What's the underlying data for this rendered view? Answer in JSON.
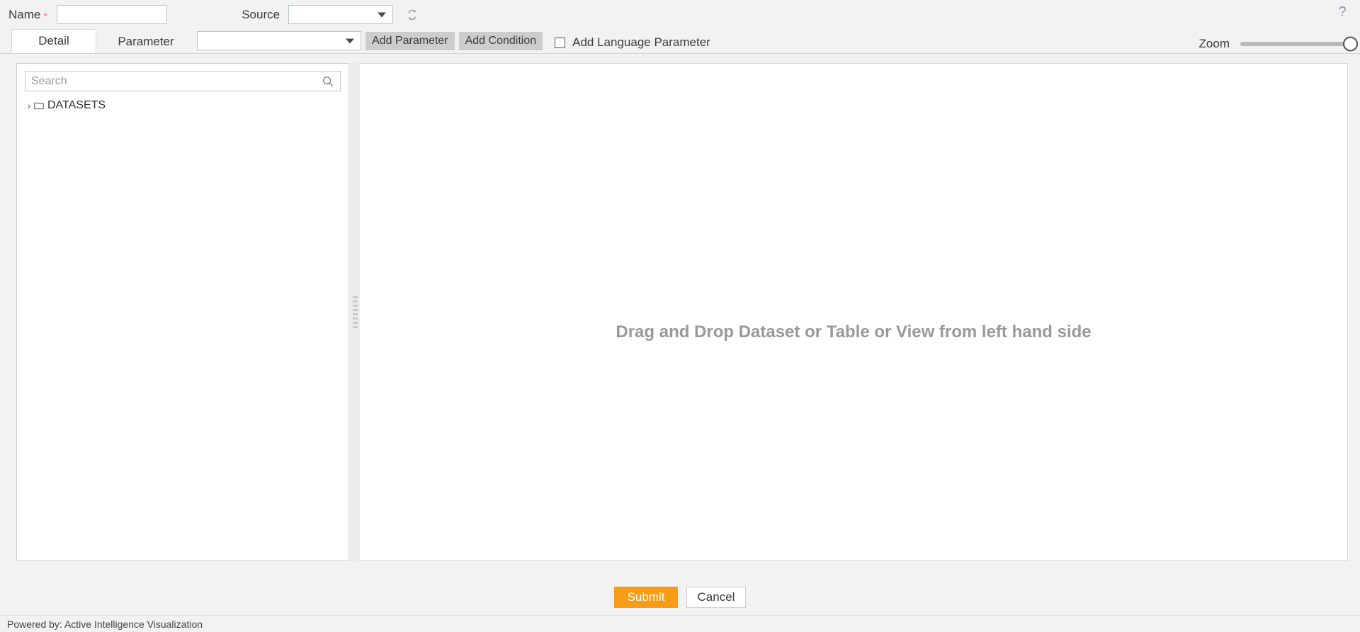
{
  "topbar": {
    "name_label": "Name",
    "required_marker": "*",
    "name_value": "",
    "name_placeholder": "",
    "source_label": "Source",
    "source_value": "",
    "refresh_icon": "refresh-icon",
    "help_icon": "question-mark-icon",
    "help_label": "?"
  },
  "tabs": [
    {
      "label": "Detail",
      "active": true
    },
    {
      "label": "Parameter",
      "active": false
    }
  ],
  "toolbar": {
    "parameter_select_value": "",
    "add_parameter_label": "Add Parameter",
    "add_condition_label": "Add Condition",
    "add_language_parameter_label": "Add Language Parameter",
    "add_language_parameter_checked": false,
    "zoom_label": "Zoom",
    "zoom_value": 100
  },
  "left_panel": {
    "search_placeholder": "Search",
    "search_value": "",
    "search_icon": "magnifier-icon",
    "tree": [
      {
        "label": "DATASETS",
        "expanded": false,
        "arrow_icon": "chevron-right-icon",
        "folder_icon": "folder-icon"
      }
    ]
  },
  "right_panel": {
    "drop_hint": "Drag and Drop Dataset or Table or View from left hand side"
  },
  "footer": {
    "submit_label": "Submit",
    "cancel_label": "Cancel"
  },
  "statusbar": {
    "powered_by": "Powered by: Active Intelligence Visualization"
  },
  "colors": {
    "accent_orange": "#f89c15",
    "page_bg": "#f2f2f2",
    "panel_bg": "#ffffff",
    "button_gray": "#cdcdcd",
    "required_star": "#f08098",
    "hint_text": "#999999"
  }
}
